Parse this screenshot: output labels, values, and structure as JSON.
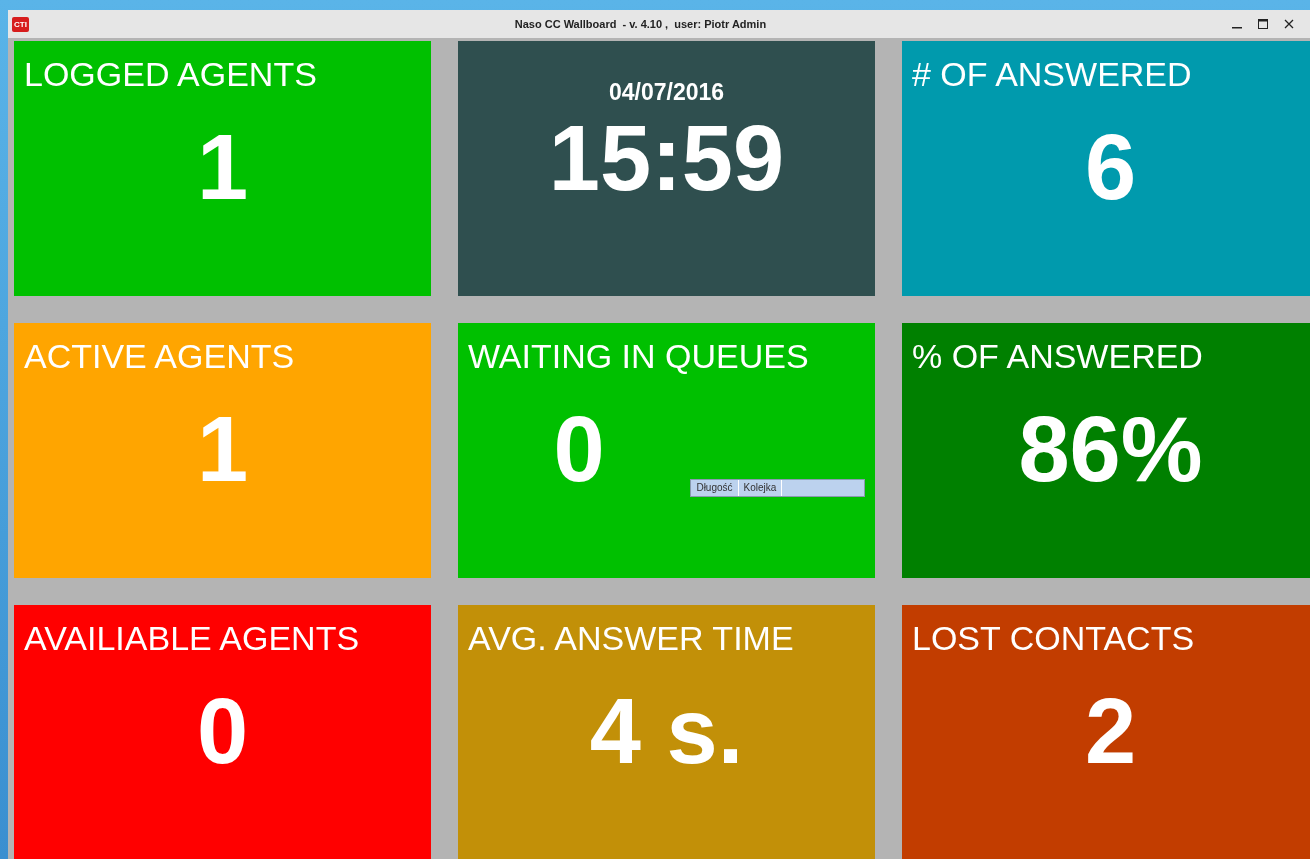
{
  "window": {
    "logo_text": "CTI",
    "title": "Naso CC Wallboard  - v. 4.10 ,  user: Piotr Admin"
  },
  "tiles": [
    {
      "kind": "stat",
      "title": "LOGGED AGENTS",
      "value": "1",
      "color": "#00c000"
    },
    {
      "kind": "clock",
      "date": "04/07/2016",
      "value": "15:59",
      "color": "#2f4f4f"
    },
    {
      "kind": "stat",
      "title": "# OF ANSWERED",
      "value": "6",
      "color": "#009aad"
    },
    {
      "kind": "stat",
      "title": "ACTIVE AGENTS",
      "value": "1",
      "color": "#ffa500"
    },
    {
      "kind": "queue",
      "title": "WAITING IN QUEUES",
      "value": "0",
      "color": "#00c000",
      "columns": [
        "Długość",
        "Kolejka"
      ]
    },
    {
      "kind": "stat",
      "title": "% OF ANSWERED",
      "value": "86%",
      "color": "#008000"
    },
    {
      "kind": "stat",
      "title": "AVAILIABLE AGENTS",
      "value": "0",
      "color": "#ff0000"
    },
    {
      "kind": "stat",
      "title": "AVG. ANSWER TIME",
      "value": "4 s.",
      "color": "#c29008"
    },
    {
      "kind": "stat",
      "title": "LOST CONTACTS",
      "value": "2",
      "color": "#c23d00"
    }
  ]
}
